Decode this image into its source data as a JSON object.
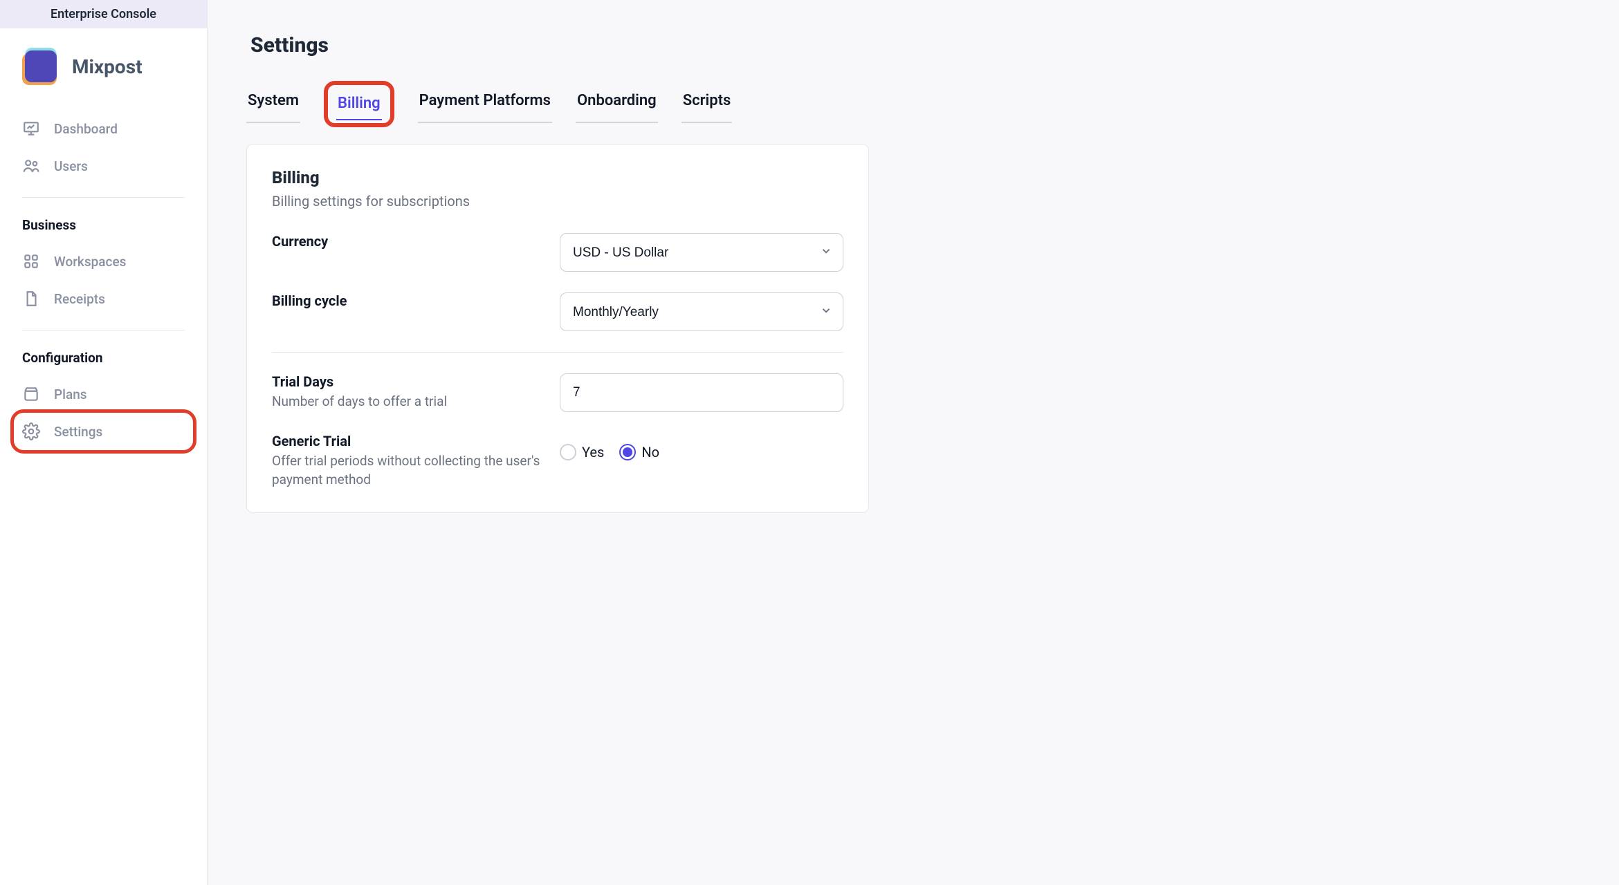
{
  "header": {
    "enterprise_label": "Enterprise Console"
  },
  "brand": {
    "name": "Mixpost"
  },
  "sidebar": {
    "items": [
      {
        "label": "Dashboard"
      },
      {
        "label": "Users"
      }
    ],
    "section_business": "Business",
    "business_items": [
      {
        "label": "Workspaces"
      },
      {
        "label": "Receipts"
      }
    ],
    "section_config": "Configuration",
    "config_items": [
      {
        "label": "Plans"
      },
      {
        "label": "Settings"
      }
    ]
  },
  "page": {
    "title": "Settings"
  },
  "tabs": [
    {
      "label": "System"
    },
    {
      "label": "Billing",
      "active": true
    },
    {
      "label": "Payment Platforms"
    },
    {
      "label": "Onboarding"
    },
    {
      "label": "Scripts"
    }
  ],
  "billing_card": {
    "title": "Billing",
    "subtitle": "Billing settings for subscriptions",
    "currency_label": "Currency",
    "currency_value": "USD - US Dollar",
    "cycle_label": "Billing cycle",
    "cycle_value": "Monthly/Yearly",
    "trial_days_label": "Trial Days",
    "trial_days_help": "Number of days to offer a trial",
    "trial_days_value": "7",
    "generic_trial_label": "Generic Trial",
    "generic_trial_help": "Offer trial periods without collecting the user's payment method",
    "generic_trial_yes": "Yes",
    "generic_trial_no": "No",
    "generic_trial_selected": "No"
  }
}
